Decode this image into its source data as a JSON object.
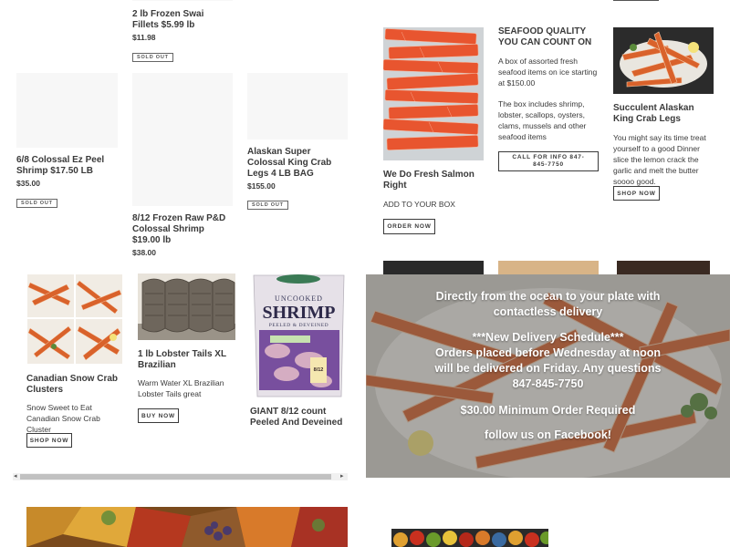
{
  "products_top": [
    {
      "title": "2 lb Frozen Swai Fillets $5.99 lb",
      "price": "$11.98",
      "badge": "SOLD OUT"
    },
    {
      "title": "6/8 Colossal Ez Peel Shrimp $17.50 LB",
      "price": "$35.00",
      "badge": "SOLD OUT"
    },
    {
      "title": "8/12 Frozen Raw P&D Colossal Shrimp $19.00 lb",
      "price": "$38.00"
    },
    {
      "title": "Alaskan Super Colossal King Crab Legs 4 LB BAG",
      "price": "$155.00",
      "badge": "SOLD OUT"
    }
  ],
  "features": {
    "salmon": {
      "title": "We Do Fresh Salmon Right",
      "text": "ADD TO YOUR BOX",
      "button": "ORDER NOW"
    },
    "quality": {
      "title": "SEAFOOD QUALITY YOU CAN COUNT ON",
      "text1": "A box of assorted fresh seafood items on ice starting at $150.00",
      "text2": "The box includes shrimp, lobster, scallops, oysters, clams, mussels and other seafood items",
      "button": "CALL FOR INFO 847-845-7750"
    },
    "crab": {
      "title": "Succulent Alaskan King Crab Legs",
      "text": "You might say its time treat yourself to a good Dinner slice the lemon crack the garlic and melt the butter  soooo good.",
      "button": "SHOP NOW"
    }
  },
  "slider": [
    {
      "title": "Canadian Snow Crab Clusters",
      "text": "Snow Sweet to Eat Canadian Snow Crab Cluster",
      "button": "SHOP NOW"
    },
    {
      "title": "1 lb Lobster Tails XL Brazilian",
      "text": "Warm Water XL Brazilian Lobster Tails great",
      "button": "BUY NOW"
    },
    {
      "title": "GIANT 8/12 count Peeled And Deveined",
      "bag": {
        "line1": "UNCOOKED",
        "line2": "SHRIMP",
        "line3": "PEELED & DEVEINED",
        "count": "8/12"
      }
    }
  ],
  "hero": {
    "line1": "Directly from the ocean to your plate with contactless delivery",
    "line2": "***New Delivery Schedule***",
    "line3": "Orders placed before Wednesday at noon will be delivered on Friday. Any questions 847-845-7750",
    "line4": "$30.00 Minimum Order Required",
    "line5": "follow us on Facebook!"
  },
  "colors": {
    "text": "#3a3a3a",
    "salmon": "#e8552f",
    "crab": "#d9622b",
    "overlay": "rgba(80,80,80,0.45)"
  },
  "icons": {
    "scroll_left": "◂",
    "scroll_right": "▸"
  }
}
